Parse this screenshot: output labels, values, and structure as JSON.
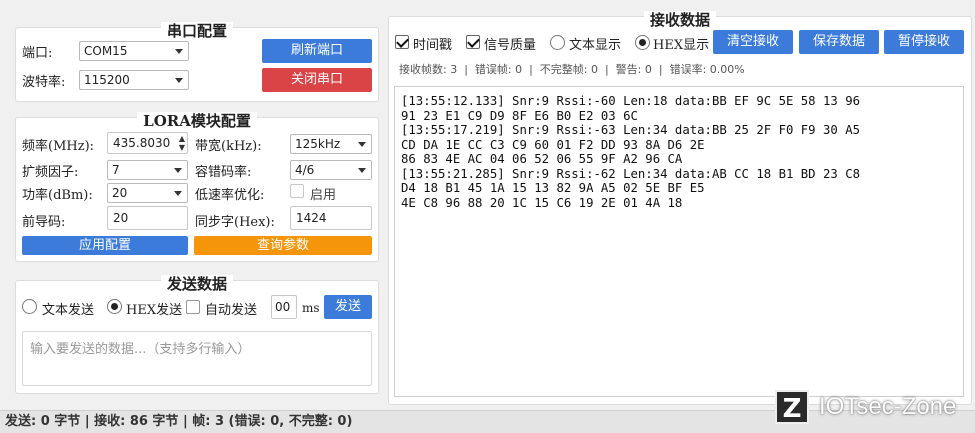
{
  "serial": {
    "title": "串口配置",
    "port_label": "端口:",
    "port_value": "COM15",
    "baud_label": "波特率:",
    "baud_value": "115200",
    "refresh_button": "刷新端口",
    "close_button": "关闭串口"
  },
  "lora": {
    "title": "LORA模块配置",
    "freq_label": "频率(MHz):",
    "freq_value": "435.8030",
    "bandwidth_label": "带宽(kHz):",
    "bandwidth_value": "125kHz",
    "sf_label": "扩频因子:",
    "sf_value": "7",
    "cr_label": "容错码率:",
    "cr_value": "4/6",
    "power_label": "功率(dBm):",
    "power_value": "20",
    "ldro_label": "低速率优化:",
    "ldro_checkbox": "启用",
    "preamble_label": "前导码:",
    "preamble_value": "20",
    "sync_label": "同步字(Hex):",
    "sync_value": "1424",
    "apply_button": "应用配置",
    "query_button": "查询参数"
  },
  "send": {
    "title": "发送数据",
    "text_mode": "文本发送",
    "hex_mode": "HEX发送",
    "auto_send": "自动发送",
    "interval_value": "00",
    "interval_unit": "ms",
    "send_button": "发送",
    "placeholder": "输入要发送的数据...（支持多行输入）"
  },
  "receive": {
    "title": "接收数据",
    "timestamp_label": "时间戳",
    "quality_label": "信号质量",
    "text_display": "文本显示",
    "hex_display": "HEX显示",
    "clear_button": "清空接收",
    "save_button": "保存数据",
    "pause_button": "暂停接收",
    "stats": "接收帧数: 3  |  错误帧: 0  |  不完整帧: 0  |  警告: 0  |  错误率: 0.00%",
    "log_lines": [
      "[13:55:12.133] Snr:9 Rssi:-60 Len:18 data:BB EF 9C 5E 58 13 96",
      "91 23 E1 C9 D9 8F E6 B0 E2 03 6C",
      "[13:55:17.219] Snr:9 Rssi:-63 Len:34 data:BB 25 2F F0 F9 30 A5",
      "CD DA 1E CC C3 C9 60 01 F2 DD 93 8A D6 2E",
      "86 83 4E AC 04 06 52 06 55 9F A2 96 CA",
      "[13:55:21.285] Snr:9 Rssi:-62 Len:34 data:AB CC 18 B1 BD 23 C8",
      "D4 18 B1 45 1A 15 13 82 9A A5 02 5E BF E5",
      "4E C8 96 88 20 1C 15 C6 19 2E 01 4A 18"
    ]
  },
  "status_bar": "发送: 0 字节 | 接收: 86 字节 | 帧: 3 (错误: 0, 不完整: 0)",
  "watermark": {
    "logo": "Z",
    "text": "IOTsec-Zone"
  },
  "colors": {
    "blue": "#3c7bd9",
    "red": "#db4446",
    "orange": "#f5960a"
  }
}
